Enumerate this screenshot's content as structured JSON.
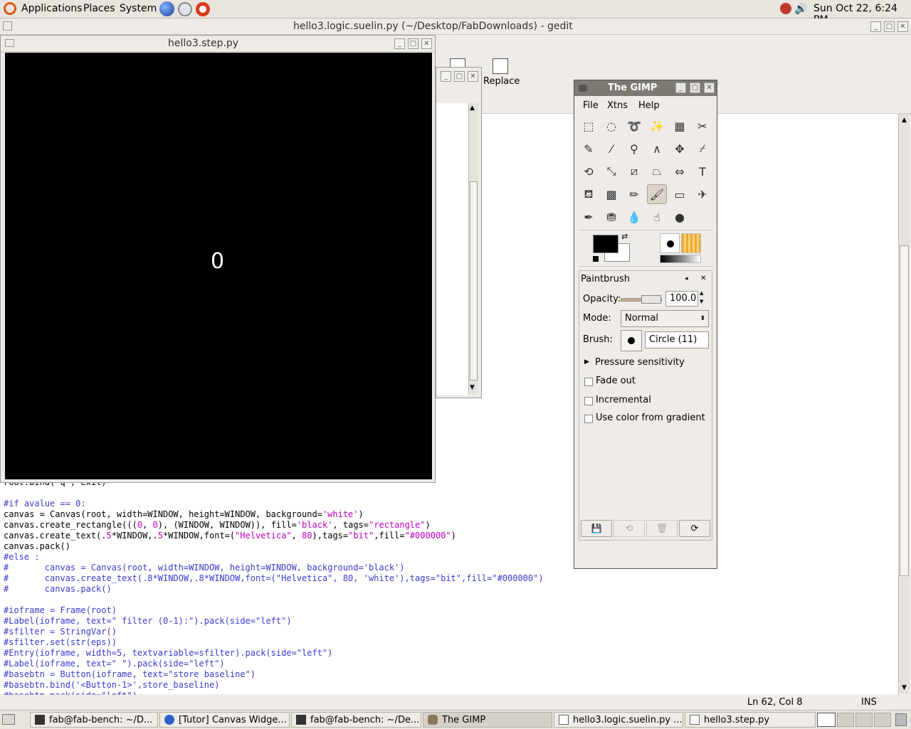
{
  "top_panel": {
    "menus": [
      "Applications",
      "Places",
      "System"
    ],
    "clock": "Sun Oct 22,  6:24 PM"
  },
  "gedit": {
    "title": "hello3.logic.suelin.py (~/Desktop/FabDownloads) - gedit",
    "toolbar_replace": "Replace",
    "status_position": "Ln 62, Col 8",
    "status_mode": "INS",
    "code_lines": [
      {
        "segments": [
          {
            "t": "root.bind('q', exit)",
            "c": ""
          }
        ]
      },
      {
        "segments": [
          {
            "t": "",
            "c": ""
          }
        ]
      },
      {
        "segments": [
          {
            "t": "#if avalue == 0:",
            "c": "cm"
          }
        ]
      },
      {
        "segments": [
          {
            "t": "canvas = Canvas(root, width=WINDOW, height=WINDOW, background=",
            "c": ""
          },
          {
            "t": "'white'",
            "c": "st"
          },
          {
            "t": ")",
            "c": ""
          }
        ]
      },
      {
        "segments": [
          {
            "t": "canvas.create_rectangle(((",
            "c": ""
          },
          {
            "t": "0",
            "c": "st"
          },
          {
            "t": ", ",
            "c": ""
          },
          {
            "t": "0",
            "c": "st"
          },
          {
            "t": "), (WINDOW, WINDOW)), fill=",
            "c": ""
          },
          {
            "t": "'black'",
            "c": "st"
          },
          {
            "t": ", tags=",
            "c": ""
          },
          {
            "t": "\"rectangle\"",
            "c": "st"
          },
          {
            "t": ")",
            "c": ""
          }
        ]
      },
      {
        "segments": [
          {
            "t": "canvas.create_text(.",
            "c": ""
          },
          {
            "t": "5",
            "c": "st"
          },
          {
            "t": "*WINDOW,.",
            "c": ""
          },
          {
            "t": "5",
            "c": "st"
          },
          {
            "t": "*WINDOW,font=(",
            "c": ""
          },
          {
            "t": "\"Helvetica\"",
            "c": "st"
          },
          {
            "t": ", ",
            "c": ""
          },
          {
            "t": "80",
            "c": "st"
          },
          {
            "t": "),tags=",
            "c": ""
          },
          {
            "t": "\"bit\"",
            "c": "st"
          },
          {
            "t": ",fill=",
            "c": ""
          },
          {
            "t": "\"#000000\"",
            "c": "st"
          },
          {
            "t": ")",
            "c": ""
          }
        ]
      },
      {
        "segments": [
          {
            "t": "canvas.pack()",
            "c": ""
          }
        ]
      },
      {
        "segments": [
          {
            "t": "#else :",
            "c": "cm"
          }
        ]
      },
      {
        "segments": [
          {
            "t": "#       canvas = Canvas(root, width=WINDOW, height=WINDOW, background='black')",
            "c": "cm"
          }
        ]
      },
      {
        "segments": [
          {
            "t": "#       canvas.create_text(.8*WINDOW,.8*WINDOW,font=(\"Helvetica\", 80, 'white'),tags=\"bit\",fill=\"#000000\")",
            "c": "cm"
          }
        ]
      },
      {
        "segments": [
          {
            "t": "#       canvas.pack()",
            "c": "cm"
          }
        ]
      },
      {
        "segments": [
          {
            "t": "",
            "c": ""
          }
        ]
      },
      {
        "segments": [
          {
            "t": "#ioframe = Frame(root)",
            "c": "cm"
          }
        ]
      },
      {
        "segments": [
          {
            "t": "#Label(ioframe, text=\" filter (0-1):\").pack(side=\"left\")",
            "c": "cm"
          }
        ]
      },
      {
        "segments": [
          {
            "t": "#sfilter = StringVar()",
            "c": "cm"
          }
        ]
      },
      {
        "segments": [
          {
            "t": "#sfilter.set(str(eps))",
            "c": "cm"
          }
        ]
      },
      {
        "segments": [
          {
            "t": "#Entry(ioframe, width=5, textvariable=sfilter).pack(side=\"left\")",
            "c": "cm"
          }
        ]
      },
      {
        "segments": [
          {
            "t": "#Label(ioframe, text=\" \").pack(side=\"left\")",
            "c": "cm"
          }
        ]
      },
      {
        "segments": [
          {
            "t": "#basebtn = Button(ioframe, text=\"store baseline\")",
            "c": "cm"
          }
        ]
      },
      {
        "segments": [
          {
            "t": "#basebtn.bind('<Button-1>',store_baseline)",
            "c": "cm"
          }
        ]
      },
      {
        "segments": [
          {
            "t": "#basebtn.pack(side=\"left\")",
            "c": "cm"
          }
        ]
      }
    ]
  },
  "step_window": {
    "title": "hello3.step.py",
    "canvas_text": "0"
  },
  "gimp": {
    "title": "The GIMP",
    "menus": [
      "File",
      "Xtns",
      "Help"
    ],
    "tools": [
      "rect-select",
      "ellipse-select",
      "lasso",
      "fuzzy-select",
      "select-by-color",
      "scissors",
      "paths",
      "color-picker",
      "zoom",
      "measure",
      "move",
      "crop",
      "rotate",
      "scale",
      "shear",
      "perspective",
      "flip",
      "text",
      "bucket-fill",
      "blend",
      "pencil",
      "paintbrush",
      "eraser",
      "airbrush",
      "ink",
      "clone",
      "blur",
      "smudge",
      "dodge-burn"
    ],
    "selected_tool": "paintbrush",
    "fg_color": "#000000",
    "bg_color": "#ffffff",
    "options_title": "Paintbrush",
    "opacity_label": "Opacity:",
    "opacity_value": "100.0",
    "opacity_fraction": 1.0,
    "mode_label": "Mode:",
    "mode_value": "Normal",
    "brush_label": "Brush:",
    "brush_value": "Circle (11)",
    "pressure_label": "Pressure sensitivity",
    "checkboxes": [
      "Fade out",
      "Incremental",
      "Use color from gradient"
    ]
  },
  "taskbar": {
    "items": [
      {
        "label": "fab@fab-bench: ~/D...",
        "icon": "terminal-icon"
      },
      {
        "label": "[Tutor] Canvas Widge...",
        "icon": "globe-icon"
      },
      {
        "label": "fab@fab-bench: ~/De...",
        "icon": "terminal-icon"
      },
      {
        "label": "The GIMP",
        "icon": "gimp-icon"
      },
      {
        "label": "hello3.logic.suelin.py ...",
        "icon": "text-editor-icon"
      },
      {
        "label": "hello3.step.py",
        "icon": "window-icon"
      }
    ]
  }
}
